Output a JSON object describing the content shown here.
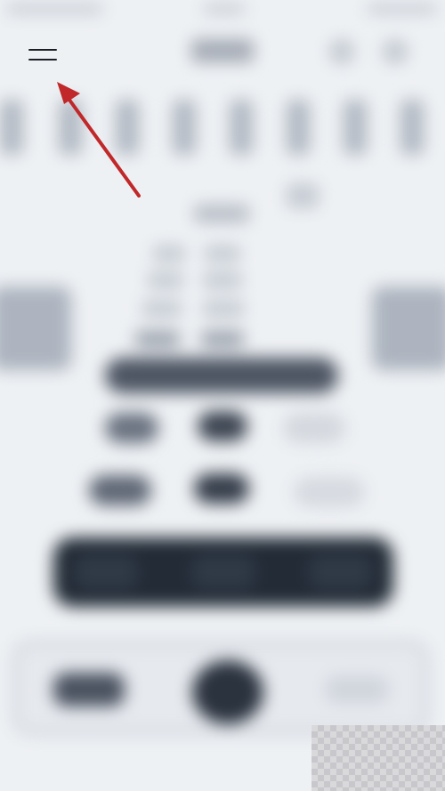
{
  "screen": {
    "description_blurred": true,
    "background_color": "#eef1f4"
  },
  "header": {
    "menu_icon": "hamburger-menu-icon"
  },
  "annotation": {
    "type": "arrow",
    "color": "#c0282a",
    "points_to": "hamburger-menu-icon"
  },
  "colors": {
    "dark_panel": "#222b36",
    "wide_bar": "#4d5563",
    "arrow": "#c0282a"
  }
}
